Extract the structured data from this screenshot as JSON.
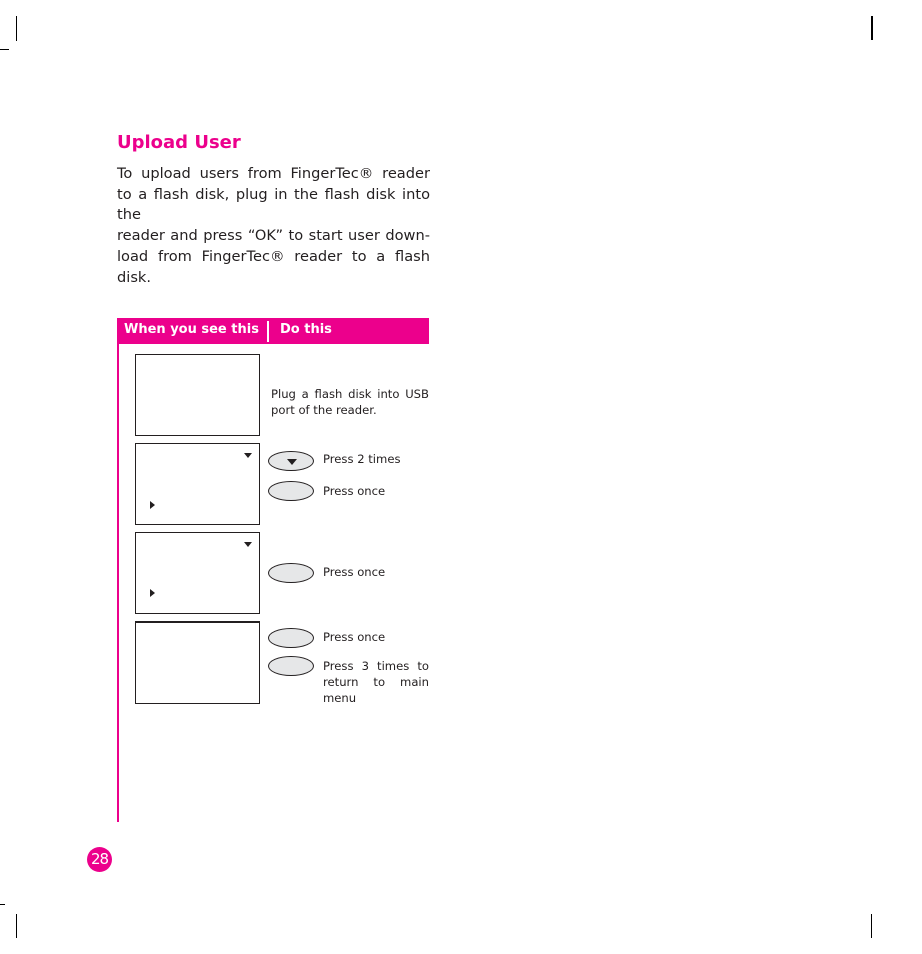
{
  "section": {
    "title": "Upload User",
    "intro_lines": [
      "To upload users from FingerTec®  reader",
      "to a flash disk, plug in the flash disk into the",
      "reader and press “OK” to start user down-",
      "load from FingerTec® reader to a flash",
      "disk."
    ]
  },
  "table": {
    "header_left": "When you see this",
    "header_right": "Do this",
    "accent_color": "#ec008c",
    "steps": [
      {
        "screen_icons": [],
        "actions": [
          {
            "key_icon": null,
            "text": "Plug a flash disk into USB port of the reader."
          }
        ]
      },
      {
        "screen_icons": [
          "scroll-down-arrow-icon",
          "selection-cursor-icon"
        ],
        "actions": [
          {
            "key_icon": "down-arrow-key-icon",
            "text": "Press 2 times"
          },
          {
            "key_icon": "blank-key-icon",
            "text": "Press once"
          }
        ]
      },
      {
        "screen_icons": [
          "scroll-down-arrow-icon",
          "selection-cursor-icon"
        ],
        "actions": [
          {
            "key_icon": "blank-key-icon",
            "text": "Press once"
          }
        ]
      },
      {
        "screen_icons": [],
        "actions": [
          {
            "key_icon": "blank-key-icon",
            "text": "Press once"
          },
          {
            "key_icon": "blank-key-icon",
            "text_lines": [
              "Press 3 times to",
              "return to main",
              "menu"
            ]
          }
        ]
      }
    ]
  },
  "footer": {
    "page_number": "28"
  }
}
